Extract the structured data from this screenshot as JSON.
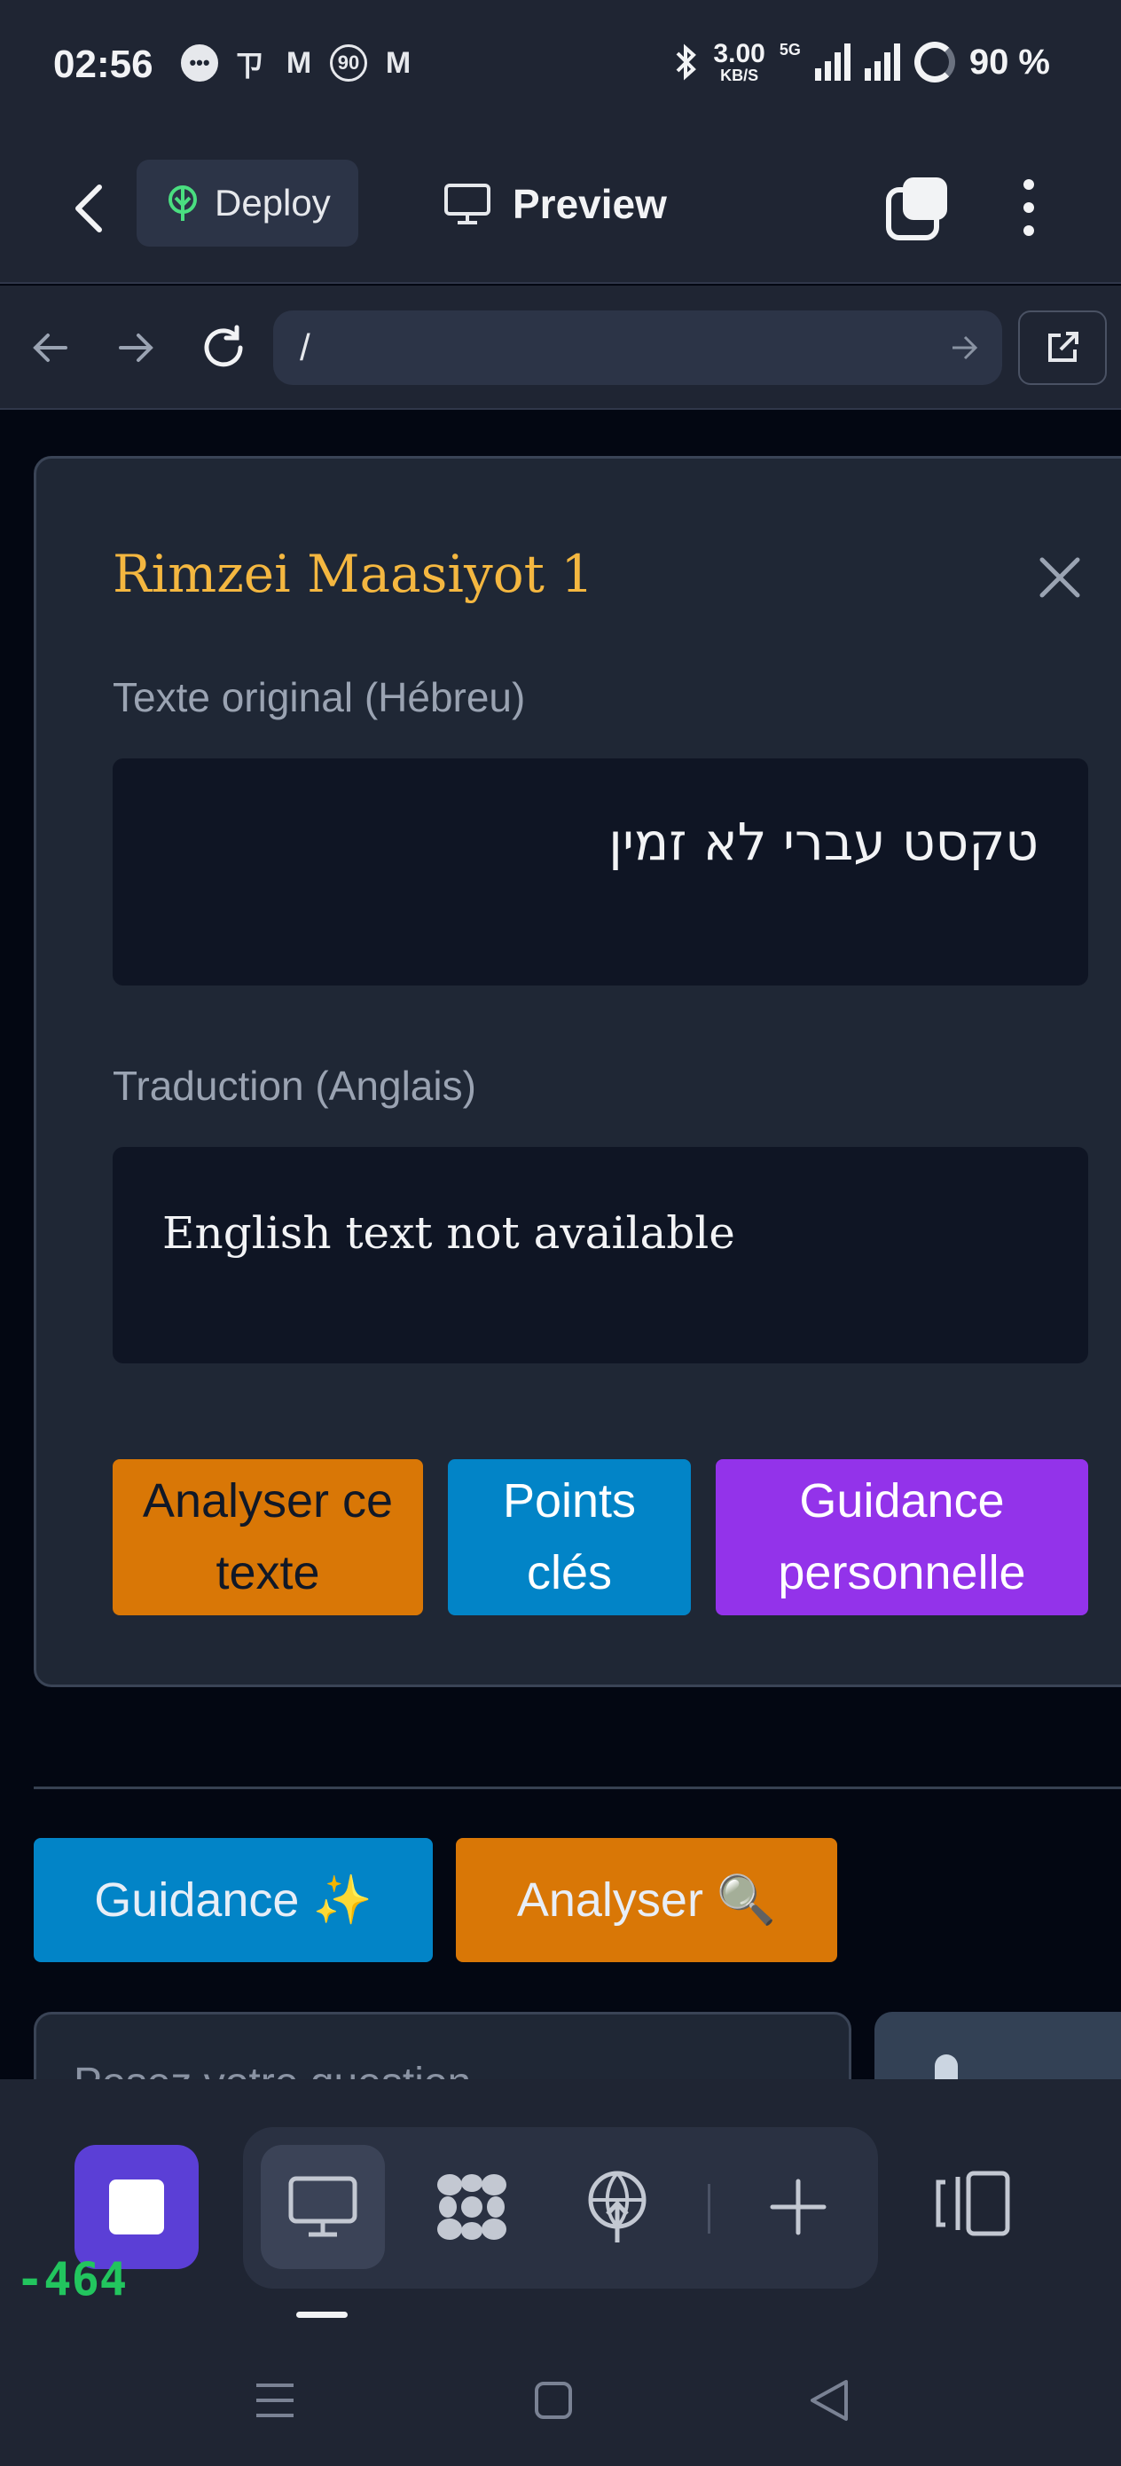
{
  "status_bar": {
    "time": "02:56",
    "netspeed_value": "3.00",
    "netspeed_unit": "KB/S",
    "network_type": "5G",
    "battery": "90 %",
    "notification_icons": [
      "chat-bubble-icon",
      "app-icon",
      "mail-icon",
      "badge-90-icon",
      "mail-icon"
    ]
  },
  "header": {
    "deploy_label": "Deploy",
    "preview_label": "Preview"
  },
  "browser": {
    "url": "/"
  },
  "card": {
    "title": "Rimzei Maasiyot 1",
    "original_label": "Texte original (Hébreu)",
    "hebrew_text": "טקסט עברי לא זמין",
    "translation_label": "Traduction (Anglais)",
    "english_text": "English text not available",
    "buttons": [
      {
        "label": "Analyser ce texte",
        "color": "#d97706"
      },
      {
        "label": "Points clés",
        "color": "#0284c7"
      },
      {
        "label": "Guidance personnelle",
        "color": "#9333ea"
      }
    ]
  },
  "quick_actions": {
    "guidance_label": "Guidance ✨",
    "analyser_label": "Analyser 🔍"
  },
  "question": {
    "placeholder": "Posez votre question..."
  },
  "toolbar": {
    "counter": "-464",
    "accent": "#5b3fd6"
  },
  "colors": {
    "title_gold": "#f4b740",
    "background": "#030712",
    "panel": "#1f2735"
  }
}
